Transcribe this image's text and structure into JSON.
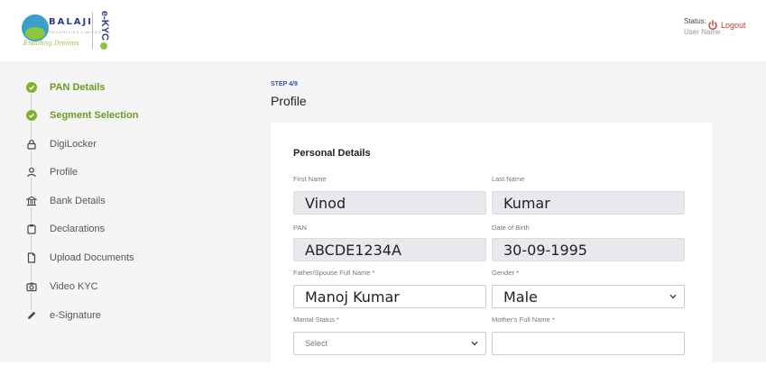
{
  "header": {
    "logo": {
      "name": "BALAJI",
      "sub": "SECURITIES LIMITED",
      "tagline": "Enabling Dreams",
      "product": "e-KYC"
    },
    "status_label": "Status:",
    "user_label": "User Name :",
    "logout_label": "Logout"
  },
  "sidebar": {
    "items": [
      {
        "label": "PAN Details",
        "icon": "check-icon",
        "state": "done"
      },
      {
        "label": "Segment Selection",
        "icon": "check-icon",
        "state": "done"
      },
      {
        "label": "DigiLocker",
        "icon": "lock-icon",
        "state": "pending"
      },
      {
        "label": "Profile",
        "icon": "person-icon",
        "state": "pending"
      },
      {
        "label": "Bank Details",
        "icon": "bank-icon",
        "state": "pending"
      },
      {
        "label": "Declarations",
        "icon": "clipboard-icon",
        "state": "pending"
      },
      {
        "label": "Upload Documents",
        "icon": "document-icon",
        "state": "pending"
      },
      {
        "label": "Video KYC",
        "icon": "camera-icon",
        "state": "pending"
      },
      {
        "label": "e-Signature",
        "icon": "pen-icon",
        "state": "pending"
      }
    ]
  },
  "main": {
    "step_tag": "STEP 4/9",
    "title": "Profile",
    "section_title": "Personal Details",
    "fields": {
      "first_name": {
        "label": "First Name",
        "value": "Vinod"
      },
      "last_name": {
        "label": "Last Name",
        "value": "Kumar"
      },
      "pan": {
        "label": "PAN",
        "value": "ABCDE1234A"
      },
      "dob": {
        "label": "Date of Birth",
        "value": "30-09-1995"
      },
      "father_name": {
        "label": "Father/Spouse Full Name *",
        "value": "Manoj Kumar"
      },
      "gender": {
        "label": "Gender *",
        "value": "Male"
      },
      "marital_status": {
        "label": "Marital Status *",
        "value": "Select"
      },
      "mother_name": {
        "label": "Mother's Full Name *",
        "value": ""
      }
    }
  },
  "colors": {
    "accent_green": "#7cb32b",
    "brand_blue": "#2e3b8c",
    "logout_red": "#c0392b"
  }
}
